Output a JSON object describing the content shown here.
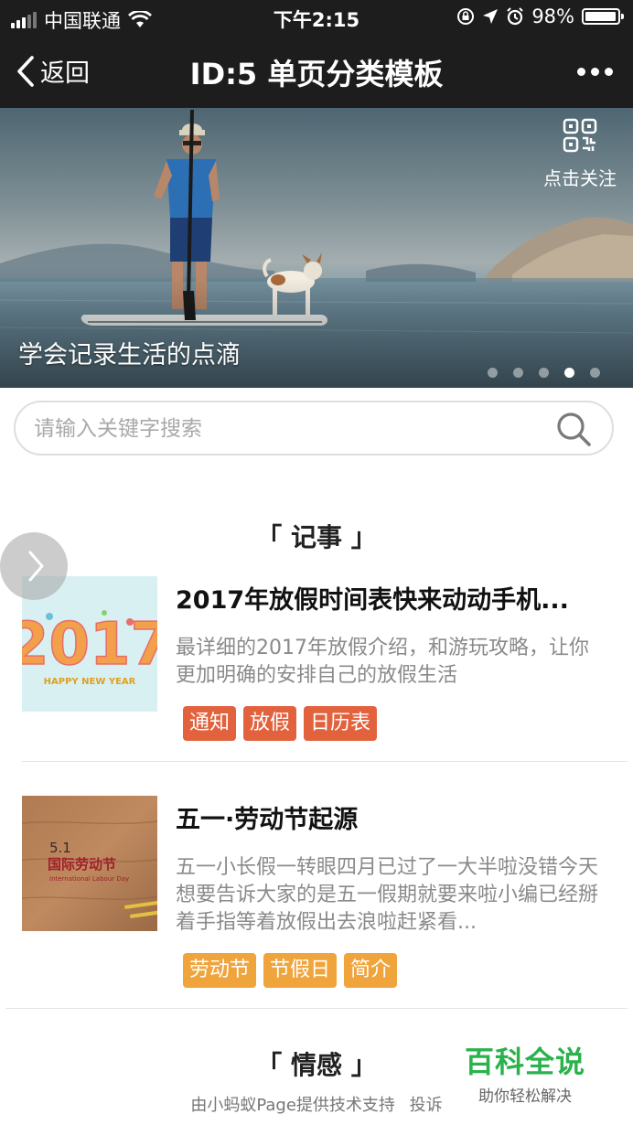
{
  "status_bar": {
    "carrier": "中国联通",
    "time": "下午2:15",
    "battery": "98%",
    "battery_level": 0.98
  },
  "nav": {
    "back_label": "返回",
    "title": "ID:5 单页分类模板"
  },
  "banner": {
    "caption": "学会记录生活的点滴",
    "follow_label": "点击关注",
    "slide_count": 5,
    "active_slide": 4
  },
  "search": {
    "placeholder": "请输入关键字搜索",
    "value": ""
  },
  "sections": [
    {
      "title": "「 记事 」",
      "articles": [
        {
          "title": "2017年放假时间表快来动动手机...",
          "description": "最详细的2017年放假介绍，和游玩攻略，让你更加明确的安排自己的放假生活",
          "thumb_text": "2017",
          "thumb_subtext": "HAPPY NEW YEAR",
          "tags": [
            "通知",
            "放假",
            "日历表"
          ],
          "tag_color": "#e2623d"
        },
        {
          "title": "五一·劳动节起源",
          "description": "五一小长假一转眼四月已过了一大半啦没错今天想要告诉大家的是五一假期就要来啦小编已经掰着手指等着放假出去浪啦赶紧看...",
          "thumb_text": "5.1 国际劳动节",
          "thumb_subtext": "International Labour Day",
          "tags": [
            "劳动节",
            "节假日",
            "简介"
          ],
          "tag_color": "#f0a43c"
        }
      ]
    },
    {
      "title": "「 情感 」",
      "articles": []
    }
  ],
  "footer": {
    "support_text": "由小蚂蚁Page提供技术支持",
    "report_label": "投诉"
  },
  "watermark": {
    "title": "百科全说",
    "subtitle": "助你轻松解决"
  },
  "colors": {
    "bar_bg": "#1d1d1d",
    "watermark_green": "#2bb24c"
  }
}
